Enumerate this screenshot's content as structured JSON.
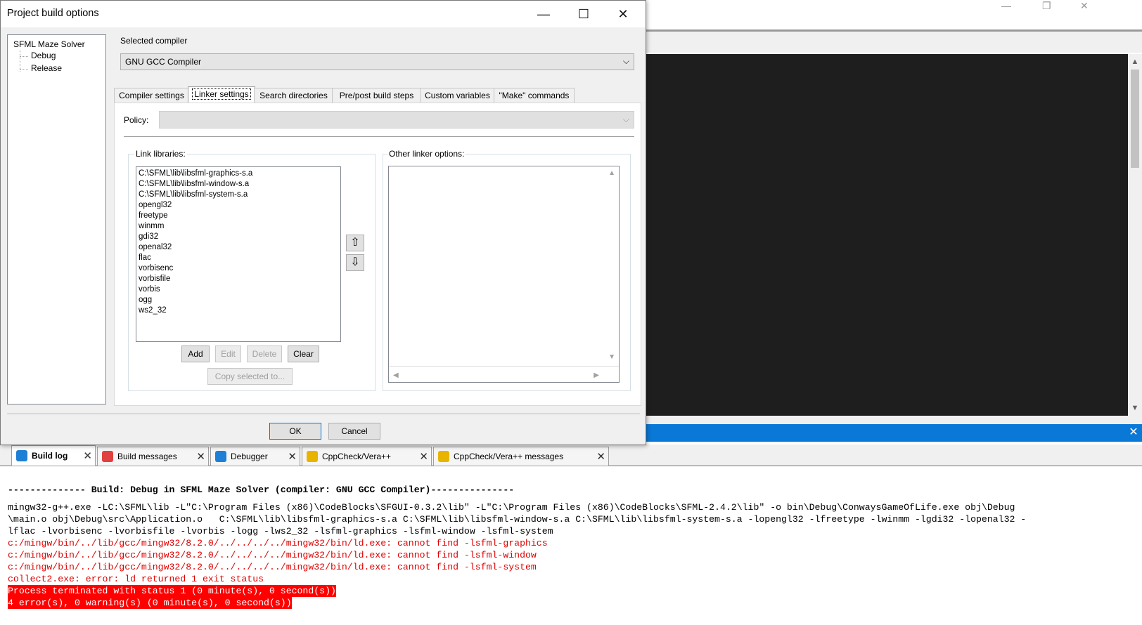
{
  "dialog": {
    "title": "Project build options",
    "tree": {
      "root": "SFML Maze Solver",
      "children": [
        "Debug",
        "Release"
      ]
    },
    "selected_compiler_label": "Selected compiler",
    "selected_compiler_value": "GNU GCC Compiler",
    "tabs": [
      "Compiler settings",
      "Linker settings",
      "Search directories",
      "Pre/post build steps",
      "Custom variables",
      "\"Make\" commands"
    ],
    "active_tab": "Linker settings",
    "policy_label": "Policy:",
    "policy_value": "",
    "link_libraries_label": "Link libraries:",
    "link_libraries": [
      "C:\\SFML\\lib\\libsfml-graphics-s.a",
      "C:\\SFML\\lib\\libsfml-window-s.a",
      "C:\\SFML\\lib\\libsfml-system-s.a",
      "opengl32",
      "freetype",
      "winmm",
      "gdi32",
      "openal32",
      "flac",
      "vorbisenc",
      "vorbisfile",
      "vorbis",
      "ogg",
      "ws2_32"
    ],
    "other_linker_label": "Other linker options:",
    "other_linker_value": "",
    "buttons": {
      "add": "Add",
      "edit": "Edit",
      "delete": "Delete",
      "clear": "Clear",
      "copy_selected": "Copy selected to...",
      "ok": "OK",
      "cancel": "Cancel"
    },
    "icons": {
      "move_up": "⇧",
      "move_down": "⇩"
    }
  },
  "log_panel": {
    "tabs": [
      {
        "label": "Build log",
        "icon": "build-log-icon",
        "icon_color": "#1e7fd6",
        "active": true
      },
      {
        "label": "Build messages",
        "icon": "build-messages-icon",
        "icon_color": "#e04040",
        "active": false
      },
      {
        "label": "Debugger",
        "icon": "debugger-icon",
        "icon_color": "#1e7fd6",
        "active": false
      },
      {
        "label": "CppCheck/Vera++",
        "icon": "pencil-icon",
        "icon_color": "#e8b400",
        "active": false
      },
      {
        "label": "CppCheck/Vera++ messages",
        "icon": "pencil-icon",
        "icon_color": "#e8b400",
        "active": false
      }
    ],
    "lines": [
      {
        "text": "-------------- Build: Debug in SFML Maze Solver (compiler: GNU GCC Compiler)---------------",
        "style": "bold"
      },
      {
        "text": "mingw32-g++.exe -LC:\\SFML\\lib -L\"C:\\Program Files (x86)\\CodeBlocks\\SFGUI-0.3.2\\lib\" -L\"C:\\Program Files (x86)\\CodeBlocks\\SFML-2.4.2\\lib\" -o bin\\Debug\\ConwaysGameOfLife.exe obj\\Debug",
        "style": "normal"
      },
      {
        "text": "\\main.o obj\\Debug\\src\\Application.o   C:\\SFML\\lib\\libsfml-graphics-s.a C:\\SFML\\lib\\libsfml-window-s.a C:\\SFML\\lib\\libsfml-system-s.a -lopengl32 -lfreetype -lwinmm -lgdi32 -lopenal32 -",
        "style": "normal"
      },
      {
        "text": "lflac -lvorbisenc -lvorbisfile -lvorbis -logg -lws2_32 -lsfml-graphics -lsfml-window -lsfml-system",
        "style": "normal"
      },
      {
        "text": "c:/mingw/bin/../lib/gcc/mingw32/8.2.0/../../../../mingw32/bin/ld.exe: cannot find -lsfml-graphics",
        "style": "red"
      },
      {
        "text": "c:/mingw/bin/../lib/gcc/mingw32/8.2.0/../../../../mingw32/bin/ld.exe: cannot find -lsfml-window",
        "style": "red"
      },
      {
        "text": "c:/mingw/bin/../lib/gcc/mingw32/8.2.0/../../../../mingw32/bin/ld.exe: cannot find -lsfml-system",
        "style": "red"
      },
      {
        "text": "collect2.exe: error: ld returned 1 exit status",
        "style": "red"
      },
      {
        "text": "Process terminated with status 1 (0 minute(s), 0 second(s))",
        "style": "highlight"
      },
      {
        "text": "4 error(s), 0 warning(s) (0 minute(s), 0 second(s))",
        "style": "highlight"
      }
    ]
  },
  "colors": {
    "accent_blue": "#0a78d7",
    "error_red": "#e00000",
    "highlight_red": "#ff0000",
    "editor_bg": "#1e1e1e"
  }
}
